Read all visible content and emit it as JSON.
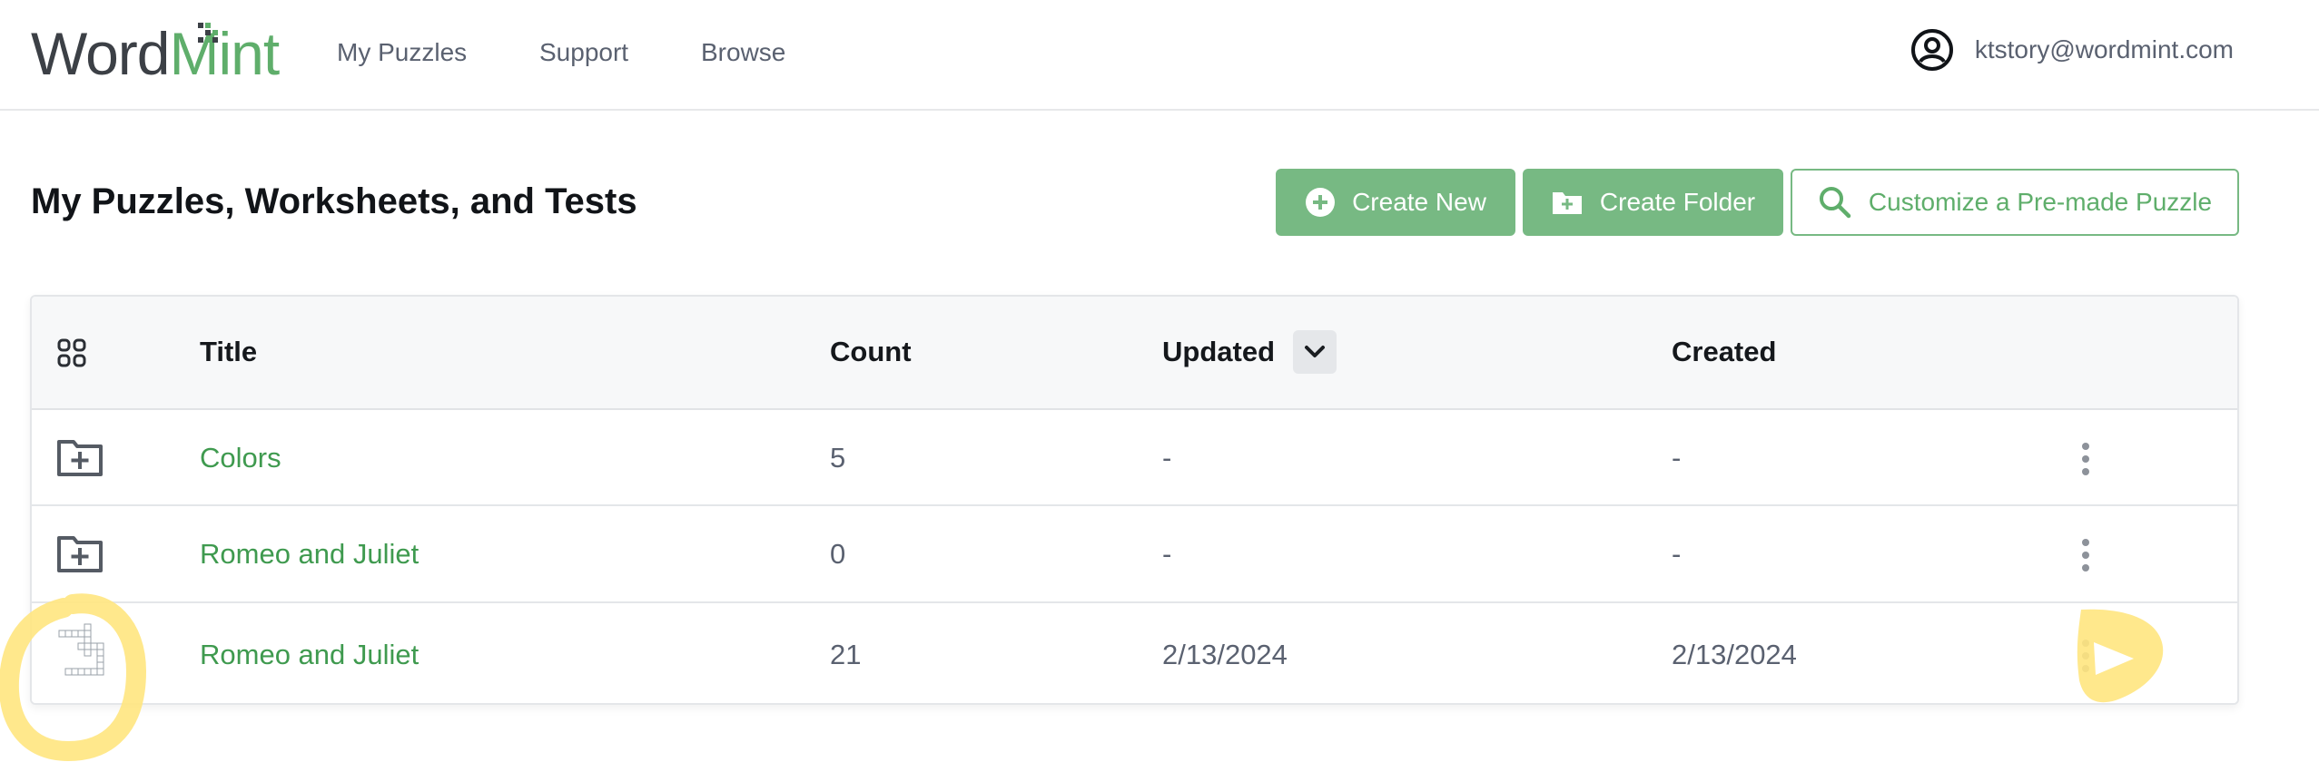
{
  "header": {
    "logo": {
      "word": "Word",
      "mint": "Mint"
    },
    "nav": [
      {
        "label": "My Puzzles"
      },
      {
        "label": "Support"
      },
      {
        "label": "Browse"
      }
    ],
    "user": {
      "email": "ktstory@wordmint.com",
      "icon": "user-circle-icon"
    }
  },
  "page": {
    "title": "My Puzzles, Worksheets, and Tests",
    "buttons": {
      "create_new": "Create New",
      "create_folder": "Create Folder",
      "customize": "Customize a Pre-made Puzzle"
    }
  },
  "table": {
    "columns": [
      "Title",
      "Count",
      "Updated",
      "Created"
    ],
    "sort_column": "Updated",
    "sort_direction": "descending",
    "rows": [
      {
        "type": "folder",
        "title": "Colors",
        "count": "5",
        "updated": "-",
        "created": "-"
      },
      {
        "type": "folder",
        "title": "Romeo and Juliet",
        "count": "0",
        "updated": "-",
        "created": "-"
      },
      {
        "type": "puzzle",
        "title": "Romeo and Juliet",
        "count": "21",
        "updated": "2/13/2024",
        "created": "2/13/2024"
      }
    ]
  },
  "colors": {
    "brand_green": "#77b983",
    "link_green": "#3f9a4f",
    "highlight_yellow": "#ffe680"
  }
}
